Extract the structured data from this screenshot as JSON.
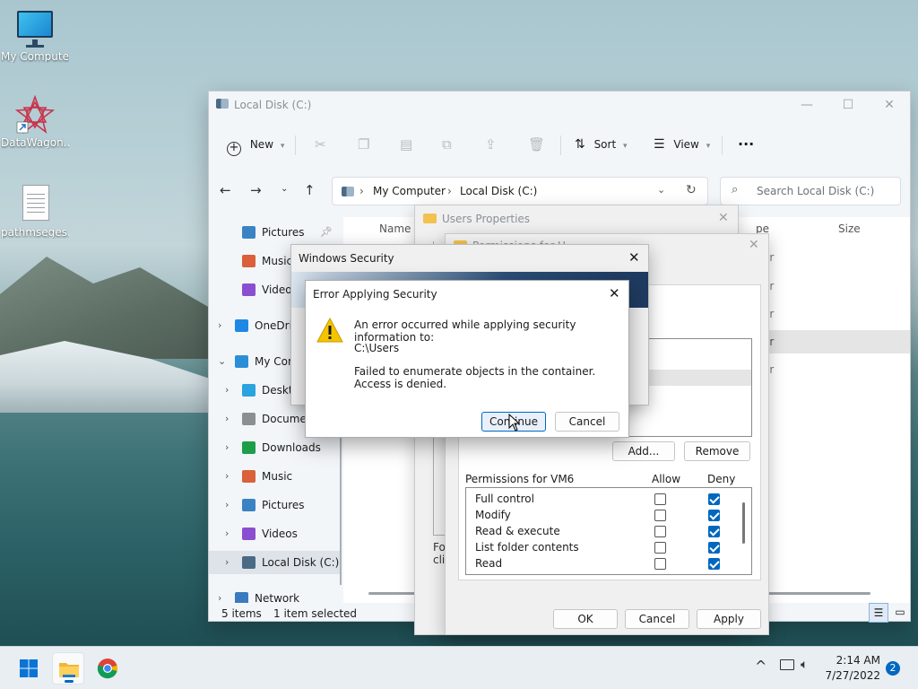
{
  "desktop": {
    "icons": [
      {
        "label": "My Computer",
        "icon": "monitor-icon"
      },
      {
        "label": "DataWagon...",
        "icon": "app-shortcut-icon"
      },
      {
        "label": "pathmseges...",
        "icon": "text-file-icon"
      }
    ]
  },
  "explorer": {
    "title": "Local Disk (C:)",
    "controls": {
      "minimize": "—",
      "maximize": "☐",
      "close": "✕"
    },
    "toolbar": {
      "new_label": "New",
      "sort_label": "Sort",
      "view_label": "View",
      "more_label": "···"
    },
    "address": {
      "crumbs": [
        "My Computer",
        "Local Disk (C:)"
      ],
      "search_placeholder": "Search Local Disk (C:)"
    },
    "nav": [
      {
        "label": "Pictures",
        "indent": true,
        "chevron": false,
        "pinned": true,
        "color": "#3b82c4"
      },
      {
        "label": "Music",
        "indent": true,
        "chevron": false,
        "pinned": false,
        "color": "#d9603b"
      },
      {
        "label": "Videos",
        "indent": true,
        "chevron": false,
        "pinned": false,
        "color": "#8a4fd0"
      },
      {
        "label": "OneDrive",
        "indent": false,
        "chevron": "›",
        "pinned": false,
        "color": "#1e88e5"
      },
      {
        "label": "My Computer",
        "indent": false,
        "chevron": "⌄",
        "pinned": false,
        "color": "#2b8fd8"
      },
      {
        "label": "Desktop",
        "indent": true,
        "chevron": "›",
        "pinned": false,
        "color": "#2aa3e0"
      },
      {
        "label": "Documents",
        "indent": true,
        "chevron": "›",
        "pinned": false,
        "color": "#8a8f94"
      },
      {
        "label": "Downloads",
        "indent": true,
        "chevron": "›",
        "pinned": false,
        "color": "#1e9e4a"
      },
      {
        "label": "Music",
        "indent": true,
        "chevron": "›",
        "pinned": false,
        "color": "#d9603b"
      },
      {
        "label": "Pictures",
        "indent": true,
        "chevron": "›",
        "pinned": false,
        "color": "#3b82c4"
      },
      {
        "label": "Videos",
        "indent": true,
        "chevron": "›",
        "pinned": false,
        "color": "#8a4fd0"
      },
      {
        "label": "Local Disk (C:)",
        "indent": true,
        "chevron": "›",
        "pinned": false,
        "color": "#4a6a86",
        "selected": true
      },
      {
        "label": "Network",
        "indent": false,
        "chevron": "›",
        "pinned": false,
        "color": "#3a7bbf"
      }
    ],
    "columns": {
      "name": "Name",
      "type": "pe",
      "size": "Size"
    },
    "row_fragments": [
      "er",
      "er",
      "er",
      "er",
      "er"
    ],
    "status": {
      "items": "5 items",
      "selected": "1 item selected"
    }
  },
  "users_properties": {
    "title": "Users Properties",
    "close": "✕",
    "fragment_lines": [
      "For",
      "clic"
    ]
  },
  "permissions": {
    "title_fragment": "Permissions for U...",
    "close": "✕",
    "add_label": "Add...",
    "remove_label": "Remove",
    "header": {
      "label": "Permissions for VM6",
      "allow": "Allow",
      "deny": "Deny"
    },
    "rows": [
      {
        "name": "Full control",
        "allow": false,
        "deny": true
      },
      {
        "name": "Modify",
        "allow": false,
        "deny": true
      },
      {
        "name": "Read & execute",
        "allow": false,
        "deny": true
      },
      {
        "name": "List folder contents",
        "allow": false,
        "deny": true
      },
      {
        "name": "Read",
        "allow": false,
        "deny": true
      }
    ],
    "ok_label": "OK",
    "cancel_label": "Cancel",
    "apply_label": "Apply"
  },
  "windows_security": {
    "title": "Windows Security",
    "close": "✕"
  },
  "error_dialog": {
    "title": "Error Applying Security",
    "close": "✕",
    "line1": "An error occurred while applying security information to:",
    "path": "C:\\Users",
    "line3": "Failed to enumerate objects in the container. Access is denied.",
    "continue_label": "Continue",
    "cancel_label": "Cancel"
  },
  "taskbar": {
    "time": "2:14 AM",
    "date": "7/27/2022",
    "notification_count": "2",
    "chevron": "^"
  },
  "colors": {
    "accent": "#0067c0",
    "warning": "#f5c400"
  }
}
